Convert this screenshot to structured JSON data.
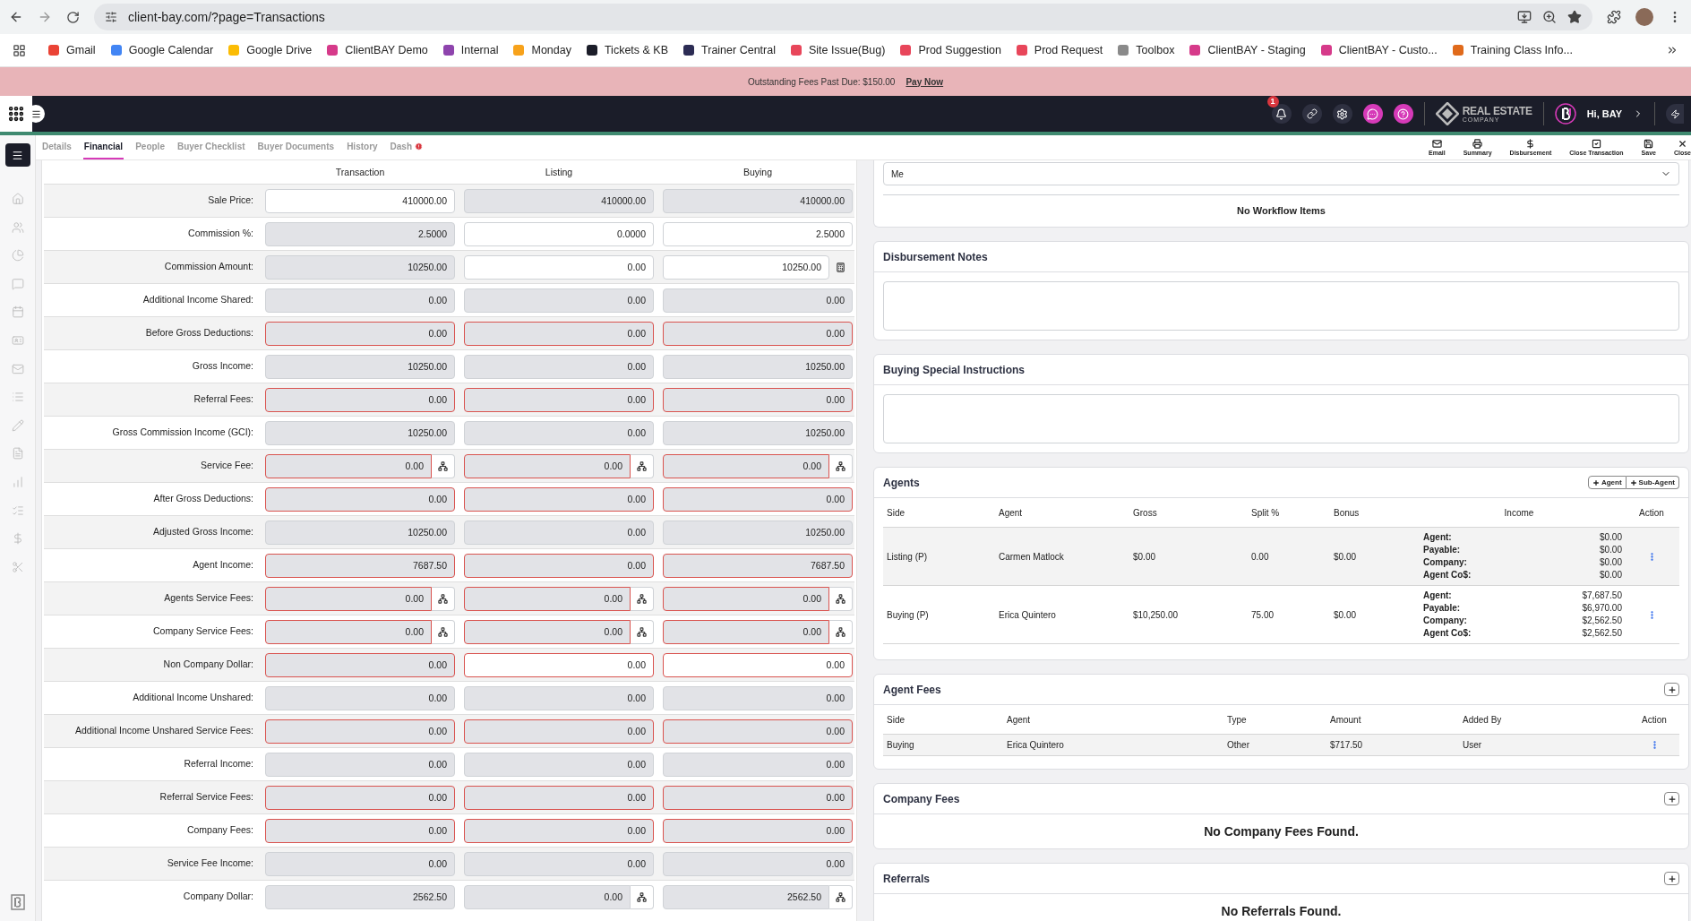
{
  "browser": {
    "url": "client-bay.com/?page=Transactions",
    "bookmarks": [
      {
        "label": "Gmail",
        "color": "#ea4335"
      },
      {
        "label": "Google Calendar",
        "color": "#4285f4"
      },
      {
        "label": "Google Drive",
        "color": "#fbbc04"
      },
      {
        "label": "ClientBAY Demo",
        "color": "#d63a8a"
      },
      {
        "label": "Internal",
        "color": "#8e44ad"
      },
      {
        "label": "Monday",
        "color": "#f7a21b"
      },
      {
        "label": "Tickets & KB",
        "color": "#1b1d29"
      },
      {
        "label": "Trainer Central",
        "color": "#2c2c54"
      },
      {
        "label": "Site Issue(Bug)",
        "color": "#e8465a"
      },
      {
        "label": "Prod Suggestion",
        "color": "#e8465a"
      },
      {
        "label": "Prod Request",
        "color": "#e8465a"
      },
      {
        "label": "Toolbox",
        "color": "#8a8a8a"
      },
      {
        "label": "ClientBAY - Staging",
        "color": "#d63a8a"
      },
      {
        "label": "ClientBAY - Custo...",
        "color": "#d63a8a"
      },
      {
        "label": "Training Class Info...",
        "color": "#e06a1b"
      }
    ]
  },
  "banner": {
    "text": "Outstanding Fees Past Due: $150.00",
    "link": "Pay Now"
  },
  "topnav": {
    "notifications": "1",
    "logo_line1": "REAL ESTATE",
    "logo_line2": "COMPANY",
    "greeting": "Hi, BAY"
  },
  "tabs": [
    {
      "label": "Details",
      "selected": false,
      "alert": false
    },
    {
      "label": "Financial",
      "selected": true,
      "alert": false
    },
    {
      "label": "People",
      "selected": false,
      "alert": false
    },
    {
      "label": "Buyer Checklist",
      "selected": false,
      "alert": false
    },
    {
      "label": "Buyer Documents",
      "selected": false,
      "alert": false
    },
    {
      "label": "History",
      "selected": false,
      "alert": false
    },
    {
      "label": "Dash",
      "selected": false,
      "alert": true
    }
  ],
  "toolbar": [
    {
      "label": "Email",
      "kind": "email"
    },
    {
      "label": "Summary",
      "kind": "print"
    },
    {
      "label": "Disbursement",
      "kind": "dollar"
    },
    {
      "label": "Close Transaction",
      "kind": "check"
    },
    {
      "label": "Save",
      "kind": "save"
    },
    {
      "label": "Close",
      "kind": "close"
    }
  ],
  "financial": {
    "columns": [
      "Transaction",
      "Listing",
      "Buying"
    ],
    "rows": [
      {
        "label": "Sale Price:",
        "cells": [
          {
            "value": "410000.00",
            "editable": true,
            "error": false
          },
          {
            "value": "410000.00",
            "editable": false,
            "error": false
          },
          {
            "value": "410000.00",
            "editable": false,
            "error": false
          }
        ]
      },
      {
        "label": "Commission %:",
        "cells": [
          {
            "value": "2.5000",
            "editable": false,
            "error": false
          },
          {
            "value": "0.0000",
            "editable": true,
            "error": false
          },
          {
            "value": "2.5000",
            "editable": true,
            "error": false
          }
        ]
      },
      {
        "label": "Commission Amount:",
        "cells": [
          {
            "value": "10250.00",
            "editable": false,
            "error": false
          },
          {
            "value": "0.00",
            "editable": true,
            "error": false
          },
          {
            "value": "10250.00",
            "editable": true,
            "error": false,
            "calculator_button": true
          }
        ]
      },
      {
        "label": "Additional Income Shared:",
        "cells": [
          {
            "value": "0.00",
            "editable": false,
            "error": false
          },
          {
            "value": "0.00",
            "editable": false,
            "error": false
          },
          {
            "value": "0.00",
            "editable": false,
            "error": false
          }
        ]
      },
      {
        "label": "Before Gross Deductions:",
        "cells": [
          {
            "value": "0.00",
            "editable": false,
            "error": true
          },
          {
            "value": "0.00",
            "editable": false,
            "error": true
          },
          {
            "value": "0.00",
            "editable": false,
            "error": true
          }
        ]
      },
      {
        "label": "Gross Income:",
        "cells": [
          {
            "value": "10250.00",
            "editable": false,
            "error": false
          },
          {
            "value": "0.00",
            "editable": false,
            "error": false
          },
          {
            "value": "10250.00",
            "editable": false,
            "error": false
          }
        ]
      },
      {
        "label": "Referral Fees:",
        "cells": [
          {
            "value": "0.00",
            "editable": false,
            "error": true
          },
          {
            "value": "0.00",
            "editable": false,
            "error": true
          },
          {
            "value": "0.00",
            "editable": false,
            "error": true
          }
        ]
      },
      {
        "label": "Gross Commission Income (GCI):",
        "cells": [
          {
            "value": "10250.00",
            "editable": false,
            "error": false
          },
          {
            "value": "0.00",
            "editable": false,
            "error": false
          },
          {
            "value": "10250.00",
            "editable": false,
            "error": false
          }
        ]
      },
      {
        "label": "Service Fee:",
        "cells": [
          {
            "value": "0.00",
            "editable": false,
            "error": true,
            "split_button": true
          },
          {
            "value": "0.00",
            "editable": false,
            "error": true,
            "split_button": true
          },
          {
            "value": "0.00",
            "editable": false,
            "error": true,
            "split_button": true
          }
        ]
      },
      {
        "label": "After Gross Deductions:",
        "cells": [
          {
            "value": "0.00",
            "editable": false,
            "error": true
          },
          {
            "value": "0.00",
            "editable": false,
            "error": true
          },
          {
            "value": "0.00",
            "editable": false,
            "error": true
          }
        ]
      },
      {
        "label": "Adjusted Gross Income:",
        "cells": [
          {
            "value": "10250.00",
            "editable": false,
            "error": false
          },
          {
            "value": "0.00",
            "editable": false,
            "error": false
          },
          {
            "value": "10250.00",
            "editable": false,
            "error": false
          }
        ]
      },
      {
        "label": "Agent Income:",
        "cells": [
          {
            "value": "7687.50",
            "editable": false,
            "error": true
          },
          {
            "value": "0.00",
            "editable": false,
            "error": true
          },
          {
            "value": "7687.50",
            "editable": false,
            "error": true
          }
        ]
      },
      {
        "label": "Agents Service Fees:",
        "cells": [
          {
            "value": "0.00",
            "editable": false,
            "error": true,
            "split_button": true
          },
          {
            "value": "0.00",
            "editable": false,
            "error": true,
            "split_button": true
          },
          {
            "value": "0.00",
            "editable": false,
            "error": true,
            "split_button": true
          }
        ]
      },
      {
        "label": "Company Service Fees:",
        "cells": [
          {
            "value": "0.00",
            "editable": false,
            "error": true,
            "split_button": true
          },
          {
            "value": "0.00",
            "editable": false,
            "error": true,
            "split_button": true
          },
          {
            "value": "0.00",
            "editable": false,
            "error": true,
            "split_button": true
          }
        ]
      },
      {
        "label": "Non Company Dollar:",
        "cells": [
          {
            "value": "0.00",
            "editable": false,
            "error": true
          },
          {
            "value": "0.00",
            "editable": true,
            "error": true
          },
          {
            "value": "0.00",
            "editable": true,
            "error": true
          }
        ]
      },
      {
        "label": "Additional Income Unshared:",
        "cells": [
          {
            "value": "0.00",
            "editable": false,
            "error": false
          },
          {
            "value": "0.00",
            "editable": false,
            "error": false
          },
          {
            "value": "0.00",
            "editable": false,
            "error": false
          }
        ]
      },
      {
        "label": "Additional Income Unshared Service Fees:",
        "cells": [
          {
            "value": "0.00",
            "editable": false,
            "error": true
          },
          {
            "value": "0.00",
            "editable": false,
            "error": true
          },
          {
            "value": "0.00",
            "editable": false,
            "error": true
          }
        ]
      },
      {
        "label": "Referral Income:",
        "cells": [
          {
            "value": "0.00",
            "editable": false,
            "error": false
          },
          {
            "value": "0.00",
            "editable": false,
            "error": false
          },
          {
            "value": "0.00",
            "editable": false,
            "error": false
          }
        ]
      },
      {
        "label": "Referral Service Fees:",
        "cells": [
          {
            "value": "0.00",
            "editable": false,
            "error": true
          },
          {
            "value": "0.00",
            "editable": false,
            "error": true
          },
          {
            "value": "0.00",
            "editable": false,
            "error": true
          }
        ]
      },
      {
        "label": "Company Fees:",
        "cells": [
          {
            "value": "0.00",
            "editable": false,
            "error": true
          },
          {
            "value": "0.00",
            "editable": false,
            "error": true
          },
          {
            "value": "0.00",
            "editable": false,
            "error": true
          }
        ]
      },
      {
        "label": "Service Fee Income:",
        "cells": [
          {
            "value": "0.00",
            "editable": false,
            "error": false
          },
          {
            "value": "0.00",
            "editable": false,
            "error": false
          },
          {
            "value": "0.00",
            "editable": false,
            "error": false
          }
        ]
      },
      {
        "label": "Company Dollar:",
        "cells": [
          {
            "value": "2562.50",
            "editable": false,
            "error": false
          },
          {
            "value": "0.00",
            "editable": false,
            "error": false,
            "split_button": true
          },
          {
            "value": "2562.50",
            "editable": false,
            "error": false,
            "split_button": true
          }
        ]
      }
    ]
  },
  "workflow": {
    "assignee": "Me",
    "empty": "No Workflow Items"
  },
  "disbursement_notes": {
    "title": "Disbursement Notes"
  },
  "buying_instructions": {
    "title": "Buying Special Instructions"
  },
  "agents": {
    "title": "Agents",
    "buttons": [
      "Agent",
      "Sub-Agent"
    ],
    "columns": [
      "Side",
      "Agent",
      "Gross",
      "Split %",
      "Bonus",
      "Income",
      "Action"
    ],
    "rows": [
      {
        "side": "Listing (P)",
        "agent": "Carmen Matlock",
        "gross": "$0.00",
        "split": "0.00",
        "bonus": "$0.00",
        "income": [
          {
            "label": "Agent:",
            "value": "$0.00"
          },
          {
            "label": "Payable:",
            "value": "$0.00"
          },
          {
            "label": "Company:",
            "value": "$0.00"
          },
          {
            "label": "Agent Co$:",
            "value": "$0.00"
          }
        ]
      },
      {
        "side": "Buying (P)",
        "agent": "Erica Quintero",
        "gross": "$10,250.00",
        "split": "75.00",
        "bonus": "$0.00",
        "income": [
          {
            "label": "Agent:",
            "value": "$7,687.50"
          },
          {
            "label": "Payable:",
            "value": "$6,970.00"
          },
          {
            "label": "Company:",
            "value": "$2,562.50"
          },
          {
            "label": "Agent Co$:",
            "value": "$2,562.50"
          }
        ]
      }
    ]
  },
  "agent_fees": {
    "title": "Agent Fees",
    "columns": [
      "Side",
      "Agent",
      "Type",
      "Amount",
      "Added By",
      "Action"
    ],
    "rows": [
      {
        "side": "Buying",
        "agent": "Erica Quintero",
        "type": "Other",
        "amount": "$717.50",
        "added_by": "User"
      }
    ]
  },
  "company_fees": {
    "title": "Company Fees",
    "empty": "No Company Fees Found."
  },
  "referrals": {
    "title": "Referrals",
    "empty": "No Referrals Found."
  }
}
